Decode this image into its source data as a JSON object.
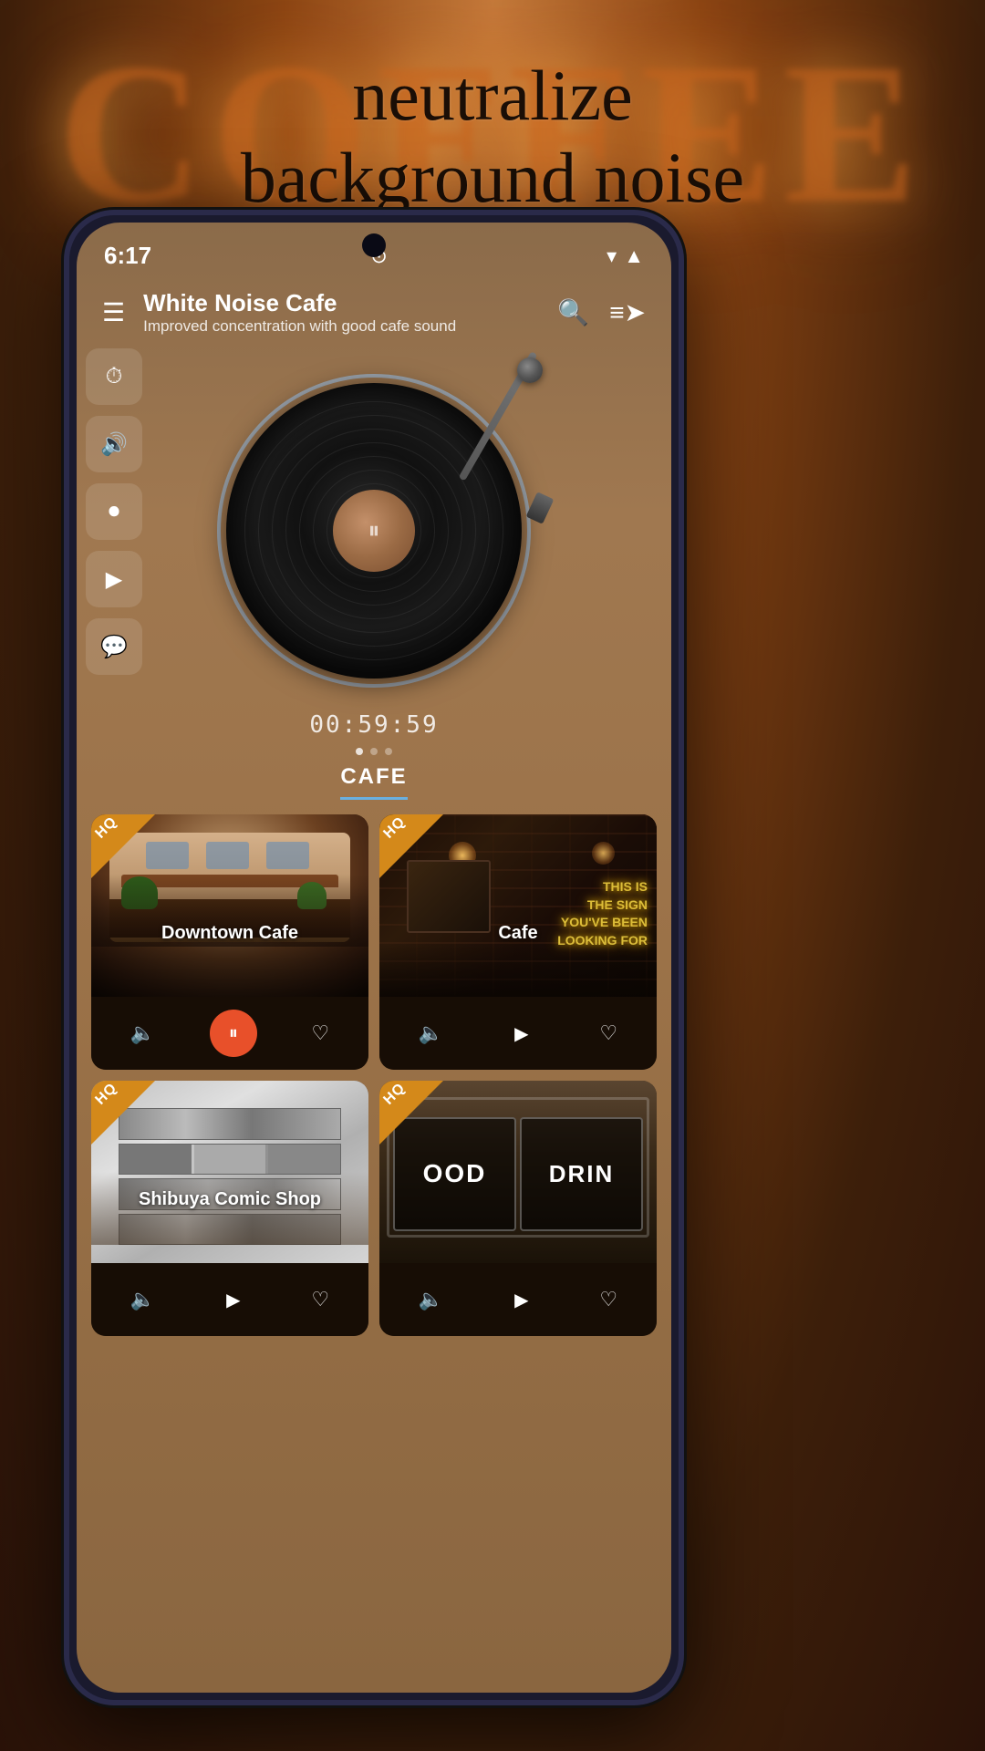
{
  "background": {
    "coffee_text": "COFFEE"
  },
  "hero": {
    "line1": "neutralize",
    "line2": "background noise"
  },
  "status_bar": {
    "time": "6:17",
    "wifi_icon": "wifi",
    "signal_icon": "signal",
    "alarm_icon": "alarm"
  },
  "header": {
    "title": "White Noise Cafe",
    "subtitle": "Improved concentration with good cafe sound",
    "menu_icon": "≡",
    "search_icon": "search",
    "playlist_icon": "playlist"
  },
  "player": {
    "timer": "00:59:59",
    "pause_icon": "⏸"
  },
  "sidebar": {
    "icons": [
      {
        "name": "timer-icon",
        "symbol": "⏱"
      },
      {
        "name": "volume-icon",
        "symbol": "🔊"
      },
      {
        "name": "record-icon",
        "symbol": "⏺"
      },
      {
        "name": "store-icon",
        "symbol": "🎬"
      },
      {
        "name": "chat-icon",
        "symbol": "💬"
      }
    ]
  },
  "tabs": {
    "items": [
      {
        "label": "CAFE",
        "active": true
      }
    ],
    "active_label": "CAFE"
  },
  "cards": [
    {
      "id": "downtown-cafe",
      "title": "Downtown Cafe",
      "hq": true,
      "is_playing": true,
      "image_type": "downtown"
    },
    {
      "id": "cafe",
      "title": "Cafe",
      "hq": true,
      "is_playing": false,
      "image_type": "cafe-dark",
      "neon_text": "THIS IS\nTHE SIGN\nYOU'VE BEEN\nLOOKING FOR"
    },
    {
      "id": "shibuya-comic-shop",
      "title": "Shibuya Comic Shop",
      "hq": true,
      "is_playing": false,
      "image_type": "comic"
    },
    {
      "id": "good-drink",
      "title": "",
      "hq": true,
      "is_playing": false,
      "image_type": "drink",
      "drink_words": [
        "OOD",
        "DRIN"
      ]
    }
  ],
  "hq_label": "HQ"
}
